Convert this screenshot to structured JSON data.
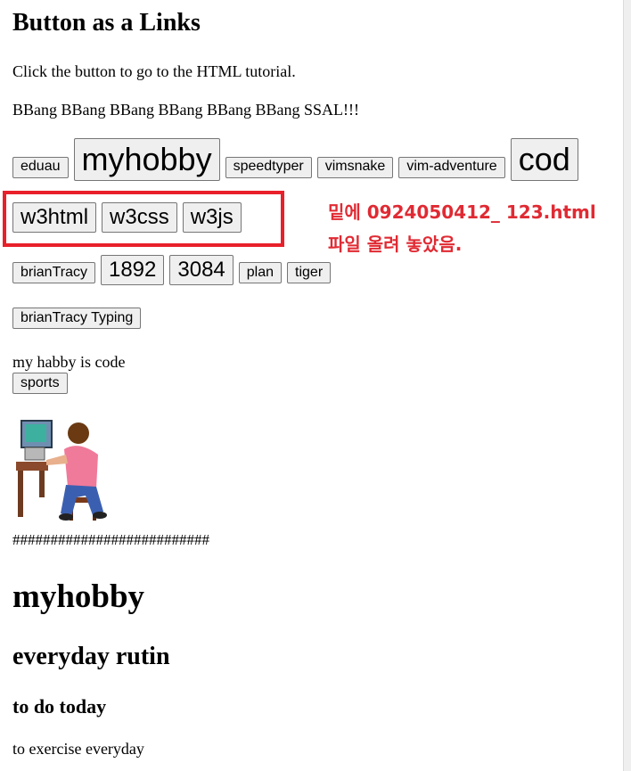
{
  "heading": "Button as a Links",
  "intro": "Click the button to go to the HTML tutorial.",
  "bbang": "BBang BBang BBang BBang BBang BBang SSAL!!!",
  "row1": [
    "eduau",
    "myhobby",
    "speedtyper",
    "vimsnake",
    "vim-adventure",
    "cod"
  ],
  "row2": [
    "w3html",
    "w3css",
    "w3js"
  ],
  "row3": [
    "brianTracy",
    "1892",
    "3084",
    "plan",
    "tiger"
  ],
  "row4": [
    "brianTracy Typing"
  ],
  "annotation": {
    "line1": "밑에 0924050412_ 123.html",
    "line2": "파일 올려 놓았음."
  },
  "habby": "my habby is code",
  "sports_label": "sports",
  "hashes": "##########################",
  "h1": "myhobby",
  "h2": "everyday rutin",
  "h3": "to do today",
  "exercise": "to exercise everyday"
}
